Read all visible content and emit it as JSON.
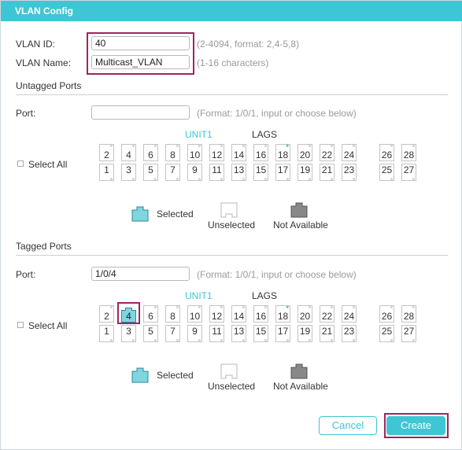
{
  "dialog": {
    "title": "VLAN Config"
  },
  "vlan": {
    "id_label": "VLAN ID:",
    "id_value": "40",
    "id_hint": "(2-4094, format: 2,4-5,8)",
    "name_label": "VLAN Name:",
    "name_value": "Multicast_VLAN",
    "name_hint": "(1-16 characters)"
  },
  "untagged": {
    "section_title": "Untagged Ports",
    "port_label": "Port:",
    "port_value": "",
    "port_hint": "(Format: 1/0/1, input or choose below)",
    "unit_tab": "UNIT1",
    "lags_tab": "LAGS",
    "select_all": "Select All",
    "ports_top": [
      "2",
      "4",
      "6",
      "8",
      "10",
      "12",
      "14",
      "16",
      "18",
      "20",
      "22",
      "24",
      "26",
      "28"
    ],
    "ports_bottom": [
      "1",
      "3",
      "5",
      "7",
      "9",
      "11",
      "13",
      "15",
      "17",
      "19",
      "21",
      "23",
      "25",
      "27"
    ],
    "selected_ports": []
  },
  "tagged": {
    "section_title": "Tagged Ports",
    "port_label": "Port:",
    "port_value": "1/0/4",
    "port_hint": "(Format: 1/0/1, input or choose below)",
    "unit_tab": "UNIT1",
    "lags_tab": "LAGS",
    "select_all": "Select All",
    "ports_top": [
      "2",
      "4",
      "6",
      "8",
      "10",
      "12",
      "14",
      "16",
      "18",
      "20",
      "22",
      "24",
      "26",
      "28"
    ],
    "ports_bottom": [
      "1",
      "3",
      "5",
      "7",
      "9",
      "11",
      "13",
      "15",
      "17",
      "19",
      "21",
      "23",
      "25",
      "27"
    ],
    "selected_ports": [
      "4"
    ]
  },
  "legend": {
    "selected": "Selected",
    "unselected": "Unselected",
    "not_available": "Not Available"
  },
  "buttons": {
    "cancel": "Cancel",
    "create": "Create"
  },
  "colors": {
    "accent": "#3fc6d4",
    "highlight_border": "#a0245f",
    "selected_fill": "#7fd6df",
    "not_available_fill": "#888888"
  }
}
